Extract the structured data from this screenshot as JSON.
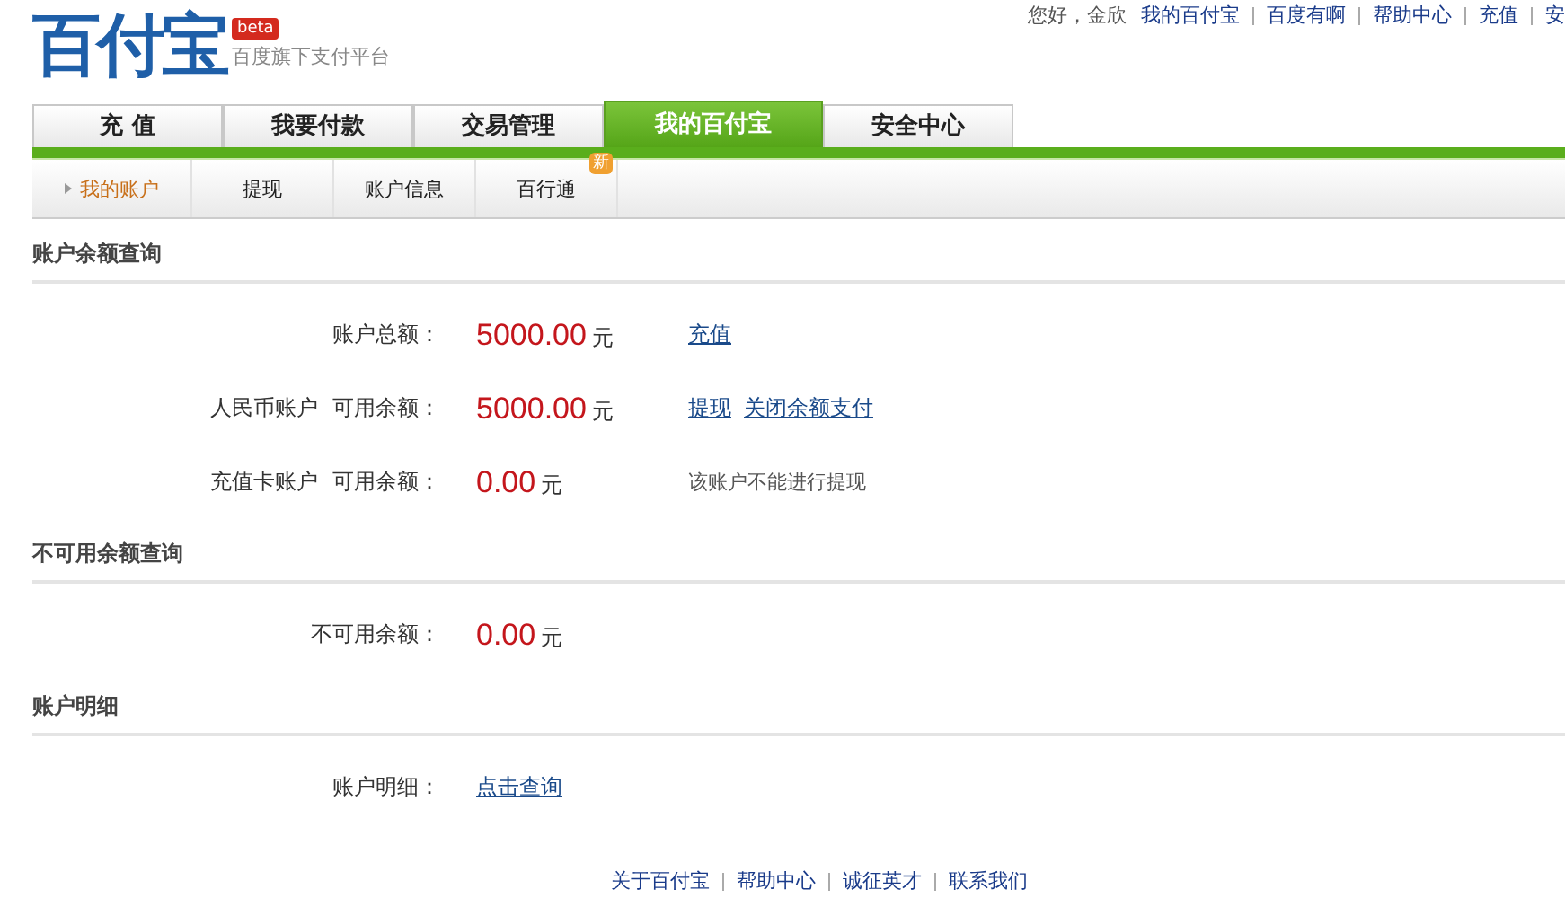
{
  "logo": {
    "name": "百付宝",
    "badge": "beta",
    "tagline": "百度旗下支付平台"
  },
  "top_bar": {
    "greeting": "您好，金欣",
    "links": [
      "我的百付宝",
      "百度有啊",
      "帮助中心",
      "充值",
      "安"
    ]
  },
  "tabs": [
    {
      "label": "充 值",
      "selected": false
    },
    {
      "label": "我要付款",
      "selected": false
    },
    {
      "label": "交易管理",
      "selected": false
    },
    {
      "label": "我的百付宝",
      "selected": true
    },
    {
      "label": "安全中心",
      "selected": false
    }
  ],
  "subnav": [
    {
      "label": "我的账户",
      "selected": true
    },
    {
      "label": "提现",
      "selected": false
    },
    {
      "label": "账户信息",
      "selected": false
    },
    {
      "label": "百行通",
      "selected": false,
      "badge": "新"
    }
  ],
  "sections": [
    {
      "title": "账户余额查询",
      "rows": [
        {
          "account": "",
          "label": "账户总额：",
          "amount": "5000.00",
          "unit": "元",
          "extras": [
            {
              "kind": "link",
              "text": "充值"
            }
          ]
        },
        {
          "account": "人民币账户",
          "label": "可用余额：",
          "amount": "5000.00",
          "unit": "元",
          "extras": [
            {
              "kind": "link",
              "text": "提现"
            },
            {
              "kind": "link",
              "text": "关闭余额支付"
            }
          ]
        },
        {
          "account": "充值卡账户",
          "label": "可用余额：",
          "amount": "0.00",
          "unit": "元",
          "extras": [
            {
              "kind": "note",
              "text": "该账户不能进行提现"
            }
          ]
        }
      ]
    },
    {
      "title": "不可用余额查询",
      "rows": [
        {
          "account": "",
          "label": "不可用余额：",
          "amount": "0.00",
          "unit": "元",
          "extras": []
        }
      ]
    },
    {
      "title": "账户明细",
      "rows": [
        {
          "account": "",
          "label": "账户明细：",
          "link": "点击查询",
          "extras": []
        }
      ]
    }
  ],
  "footer": {
    "links": [
      "关于百付宝",
      "帮助中心",
      "诚征英才",
      "联系我们"
    ]
  }
}
